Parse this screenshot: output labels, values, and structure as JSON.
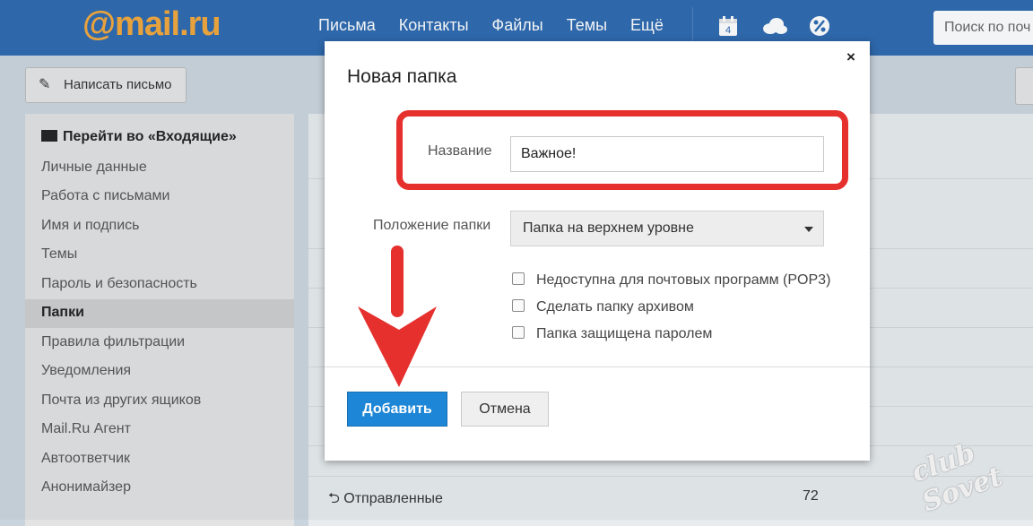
{
  "header": {
    "logo": "@mail.ru",
    "nav": [
      "Письма",
      "Контакты",
      "Файлы",
      "Темы",
      "Ещё"
    ],
    "calendar_day": "4",
    "search_placeholder": "Поиск по поч"
  },
  "toolbar": {
    "compose_label": "Написать письмо"
  },
  "sidebar": {
    "head": "Перейти во «Входящие»",
    "items": [
      "Личные данные",
      "Работа с письмами",
      "Имя и подпись",
      "Темы",
      "Пароль и безопасность",
      "Папки",
      "Правила фильтрации",
      "Уведомления",
      "Почта из других ящиков",
      "Mail.Ru Агент",
      "Автоответчик",
      "Анонимайзер"
    ],
    "active_index": 5
  },
  "main": {
    "folder_row": {
      "name": "Отправленные",
      "count": "72"
    }
  },
  "modal": {
    "title": "Новая папка",
    "close": "×",
    "name_label": "Название",
    "name_value": "Важное!",
    "position_label": "Положение папки",
    "position_value": "Папка на верхнем уровне",
    "checkboxes": [
      "Недоступна для почтовых программ (POP3)",
      "Сделать папку архивом",
      "Папка защищена паролем"
    ],
    "add_label": "Добавить",
    "cancel_label": "Отмена"
  },
  "watermark": "club Sovet",
  "colors": {
    "header": "#2f6ab0",
    "accent": "#1e86d6",
    "highlight": "#e5302d"
  }
}
